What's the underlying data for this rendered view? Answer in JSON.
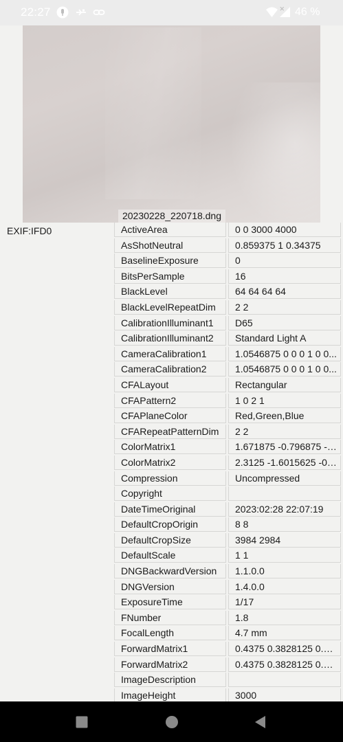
{
  "status_bar": {
    "time": "22:27",
    "battery": "46 %",
    "icons": [
      "mic-icon",
      "usb-debug-icon",
      "link-icon",
      "wifi-icon",
      "signal-icon"
    ]
  },
  "preview": {
    "filename": "20230228_220718.dng"
  },
  "exif": {
    "group": "EXIF:IFD0",
    "rows": [
      {
        "key": "ActiveArea",
        "value": "0 0 3000 4000"
      },
      {
        "key": "AsShotNeutral",
        "value": "0.859375 1 0.34375"
      },
      {
        "key": "BaselineExposure",
        "value": "0"
      },
      {
        "key": "BitsPerSample",
        "value": "16"
      },
      {
        "key": "BlackLevel",
        "value": "64 64 64 64"
      },
      {
        "key": "BlackLevelRepeatDim",
        "value": "2 2"
      },
      {
        "key": "CalibrationIlluminant1",
        "value": "D65"
      },
      {
        "key": "CalibrationIlluminant2",
        "value": "Standard Light A"
      },
      {
        "key": "CameraCalibration1",
        "value": "1.0546875 0 0 0 1 0 0..."
      },
      {
        "key": "CameraCalibration2",
        "value": "1.0546875 0 0 0 1 0 0..."
      },
      {
        "key": "CFALayout",
        "value": "Rectangular"
      },
      {
        "key": "CFAPattern2",
        "value": "1 0 2 1"
      },
      {
        "key": "CFAPlaneColor",
        "value": "Red,Green,Blue"
      },
      {
        "key": "CFARepeatPatternDim",
        "value": "2 2"
      },
      {
        "key": "ColorMatrix1",
        "value": "1.671875 -0.796875 -0...."
      },
      {
        "key": "ColorMatrix2",
        "value": "2.3125 -1.6015625 -0.4..."
      },
      {
        "key": "Compression",
        "value": "Uncompressed"
      },
      {
        "key": "Copyright",
        "value": ""
      },
      {
        "key": "DateTimeOriginal",
        "value": "2023:02:28 22:07:19"
      },
      {
        "key": "DefaultCropOrigin",
        "value": "8 8"
      },
      {
        "key": "DefaultCropSize",
        "value": "3984 2984"
      },
      {
        "key": "DefaultScale",
        "value": "1 1"
      },
      {
        "key": "DNGBackwardVersion",
        "value": "1.1.0.0"
      },
      {
        "key": "DNGVersion",
        "value": "1.4.0.0"
      },
      {
        "key": "ExposureTime",
        "value": "1/17"
      },
      {
        "key": "FNumber",
        "value": "1.8"
      },
      {
        "key": "FocalLength",
        "value": "4.7 mm"
      },
      {
        "key": "ForwardMatrix1",
        "value": "0.4375 0.3828125 0.14..."
      },
      {
        "key": "ForwardMatrix2",
        "value": "0.4375 0.3828125 0.14..."
      },
      {
        "key": "ImageDescription",
        "value": ""
      },
      {
        "key": "ImageHeight",
        "value": "3000"
      }
    ]
  },
  "nav_bar": {
    "buttons": [
      "recents-button",
      "home-button",
      "back-button"
    ]
  }
}
